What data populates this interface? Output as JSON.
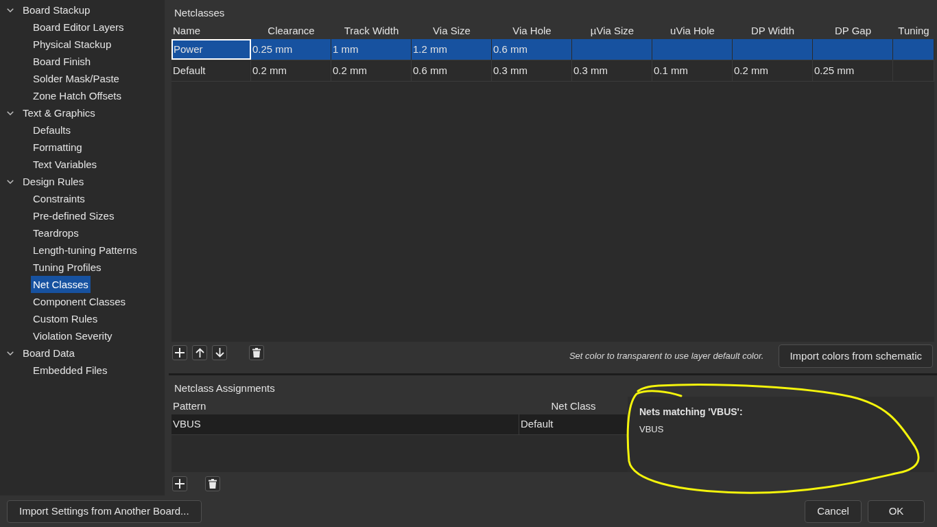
{
  "sidebar": {
    "items": [
      {
        "label": "Board Stackup",
        "expanded": true,
        "selected": false,
        "children": [
          {
            "label": "Board Editor Layers",
            "selected": false
          },
          {
            "label": "Physical Stackup",
            "selected": false
          },
          {
            "label": "Board Finish",
            "selected": false
          },
          {
            "label": "Solder Mask/Paste",
            "selected": false
          },
          {
            "label": "Zone Hatch Offsets",
            "selected": false
          }
        ]
      },
      {
        "label": "Text & Graphics",
        "expanded": true,
        "selected": false,
        "children": [
          {
            "label": "Defaults",
            "selected": false
          },
          {
            "label": "Formatting",
            "selected": false
          },
          {
            "label": "Text Variables",
            "selected": false
          }
        ]
      },
      {
        "label": "Design Rules",
        "expanded": true,
        "selected": false,
        "children": [
          {
            "label": "Constraints",
            "selected": false
          },
          {
            "label": "Pre-defined Sizes",
            "selected": false
          },
          {
            "label": "Teardrops",
            "selected": false
          },
          {
            "label": "Length-tuning Patterns",
            "selected": false
          },
          {
            "label": "Tuning Profiles",
            "selected": false
          },
          {
            "label": "Net Classes",
            "selected": true
          },
          {
            "label": "Component Classes",
            "selected": false
          },
          {
            "label": "Custom Rules",
            "selected": false
          },
          {
            "label": "Violation Severity",
            "selected": false
          }
        ]
      },
      {
        "label": "Board Data",
        "expanded": true,
        "selected": false,
        "children": [
          {
            "label": "Embedded Files",
            "selected": false
          }
        ]
      }
    ]
  },
  "netclasses": {
    "title": "Netclasses",
    "columns": [
      "Name",
      "Clearance",
      "Track Width",
      "Via Size",
      "Via Hole",
      "µVia Size",
      "uVia Hole",
      "DP Width",
      "DP Gap",
      "Tuning"
    ],
    "rows": [
      {
        "selected": true,
        "cells": [
          "Power",
          "0.25 mm",
          "1 mm",
          "1.2 mm",
          "0.6 mm"
        ]
      },
      {
        "selected": false,
        "cells": [
          "Default",
          "0.2 mm",
          "0.2 mm",
          "0.6 mm",
          "0.3 mm",
          "0.3 mm",
          "0.1 mm",
          "0.2 mm",
          "0.25 mm"
        ]
      }
    ],
    "hint": "Set color to transparent to use layer default color.",
    "import_button": "Import colors from schematic"
  },
  "assignments": {
    "title": "Netclass Assignments",
    "columns": [
      "Pattern",
      "Net Class"
    ],
    "rows": [
      {
        "cells": [
          "VBUS",
          "Default"
        ]
      }
    ]
  },
  "tooltip": {
    "title": "Nets matching 'VBUS':",
    "nets": [
      "VBUS"
    ]
  },
  "footer": {
    "import_button": "Import Settings from Another Board...",
    "cancel_button": "Cancel",
    "ok_button": "OK"
  }
}
